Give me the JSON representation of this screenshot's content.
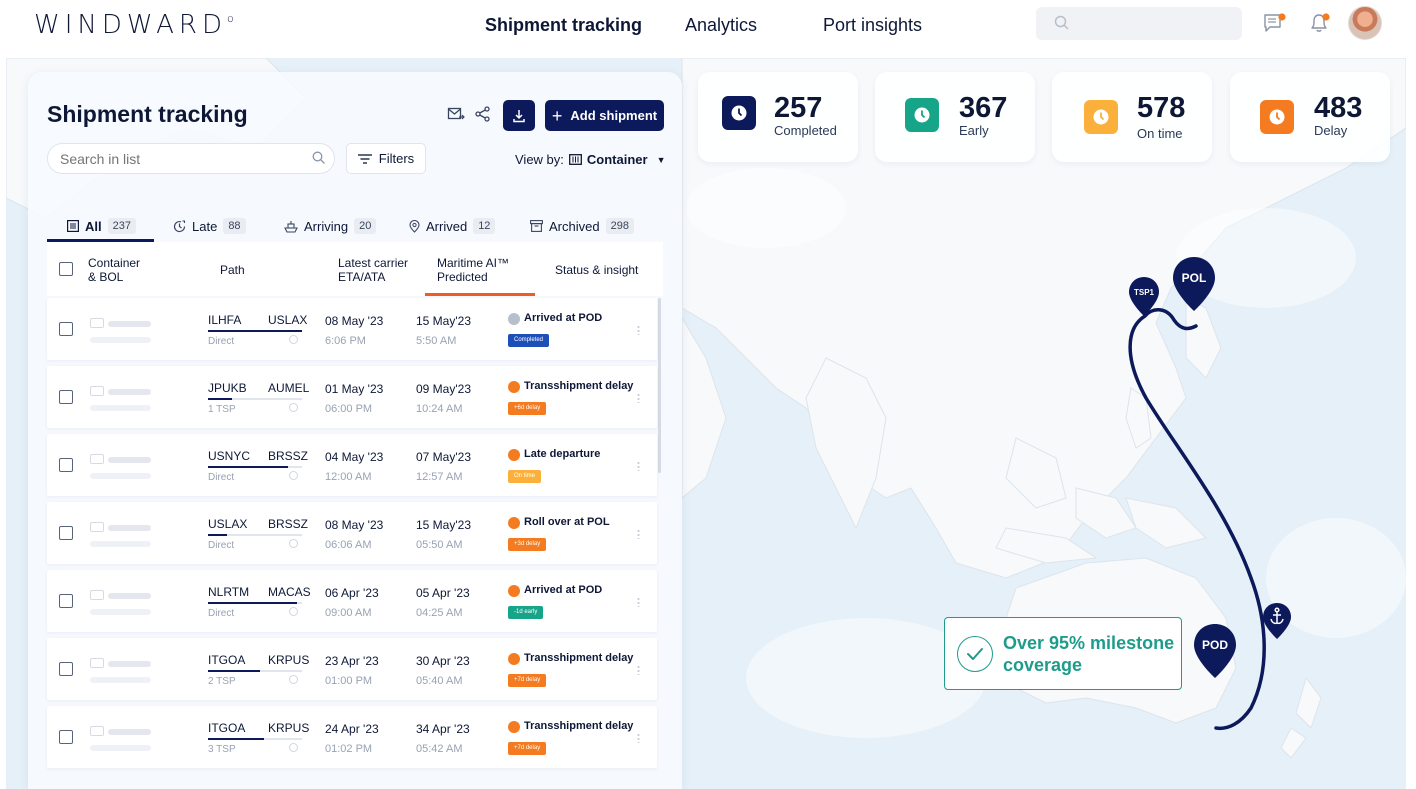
{
  "app": {
    "logo": "WINDWARD",
    "logo_mark": "o"
  },
  "nav": {
    "items": [
      {
        "label": "Shipment tracking",
        "active": true
      },
      {
        "label": "Analytics",
        "active": false
      },
      {
        "label": "Port insights",
        "active": false
      }
    ],
    "search_placeholder": "",
    "icons": [
      "search-icon",
      "messages-icon",
      "bell-icon"
    ],
    "avatar": "user-avatar"
  },
  "stats": [
    {
      "value": "257",
      "label": "Completed",
      "color": "#0c1a5b"
    },
    {
      "value": "367",
      "label": "Early",
      "color": "#17a58a"
    },
    {
      "value": "578",
      "label": "On time",
      "color": "#fbb03b"
    },
    {
      "value": "483",
      "label": "Delay",
      "color": "#f47b20"
    }
  ],
  "panel": {
    "title": "Shipment tracking",
    "add_button": "Add shipment",
    "search_placeholder": "Search in list",
    "filters_label": "Filters",
    "view_by_label": "View by:",
    "view_by_value": "Container",
    "tabs": [
      {
        "label": "All",
        "count": "237",
        "icon": "list-icon",
        "active": true
      },
      {
        "label": "Late",
        "count": "88",
        "icon": "late-clock-icon"
      },
      {
        "label": "Arriving",
        "count": "20",
        "icon": "ship-icon"
      },
      {
        "label": "Arrived",
        "count": "12",
        "icon": "location-pin-icon"
      },
      {
        "label": "Archived",
        "count": "298",
        "icon": "archive-icon"
      }
    ],
    "columns": {
      "container_1": "Container",
      "container_2": "& BOL",
      "path": "Path",
      "eta_1": "Latest carrier",
      "eta_2": "ETA/ATA",
      "ai_1": "Maritime AI™",
      "ai_2": "Predicted",
      "status": "Status & insight"
    }
  },
  "rows": [
    {
      "from": "ILHFA",
      "to": "USLAX",
      "route": "Direct",
      "progress": 1.0,
      "eta_date": "08 May '23",
      "eta_time": "6:06 PM",
      "ai_date": "15 May'23",
      "ai_time": "5:50 AM",
      "status": "Arrived at POD",
      "status_color": "#b8bfcc",
      "badge": "Completed",
      "badge_color": "#1d4fb8"
    },
    {
      "from": "JPUKB",
      "to": "AUMEL",
      "route": "1 TSP",
      "progress": 0.25,
      "eta_date": "01 May '23",
      "eta_time": "06:00 PM",
      "ai_date": "09 May'23",
      "ai_time": "10:24 AM",
      "status": "Transshipment delay",
      "status_color": "#f47b20",
      "badge": "+6d delay",
      "badge_color": "#f47b20"
    },
    {
      "from": "USNYC",
      "to": "BRSSZ",
      "route": "Direct",
      "progress": 0.85,
      "eta_date": "04 May '23",
      "eta_time": "12:00 AM",
      "ai_date": "07 May'23",
      "ai_time": "12:57 AM",
      "status": "Late departure",
      "status_color": "#f47b20",
      "badge": "On time",
      "badge_color": "#fbb03b"
    },
    {
      "from": "USLAX",
      "to": "BRSSZ",
      "route": "Direct",
      "progress": 0.2,
      "eta_date": "08 May '23",
      "eta_time": "06:06 AM",
      "ai_date": "15 May'23",
      "ai_time": "05:50 AM",
      "status": "Roll over at POL",
      "status_color": "#f47b20",
      "badge": "+3d delay",
      "badge_color": "#f47b20"
    },
    {
      "from": "NLRTM",
      "to": "MACAS",
      "route": "Direct",
      "progress": 0.95,
      "eta_date": "06 Apr '23",
      "eta_time": "09:00 AM",
      "ai_date": "05 Apr '23",
      "ai_time": "04:25 AM",
      "status": "Arrived at POD",
      "status_color": "#f47b20",
      "badge": "-1d early",
      "badge_color": "#17a58a"
    },
    {
      "from": "ITGOA",
      "to": "KRPUS",
      "route": "2 TSP",
      "progress": 0.55,
      "eta_date": "23 Apr '23",
      "eta_time": "01:00 PM",
      "ai_date": "30 Apr '23",
      "ai_time": "05:40 AM",
      "status": "Transshipment delay",
      "status_color": "#f47b20",
      "badge": "+7d delay",
      "badge_color": "#f47b20"
    },
    {
      "from": "ITGOA",
      "to": "KRPUS",
      "route": "3 TSP",
      "progress": 0.6,
      "eta_date": "24 Apr '23",
      "eta_time": "01:02 PM",
      "ai_date": "34 Apr '23",
      "ai_time": "05:42 AM",
      "status": "Transshipment delay",
      "status_color": "#f47b20",
      "badge": "+7d delay",
      "badge_color": "#f47b20"
    }
  ],
  "map": {
    "pins": [
      {
        "label": "TSP1"
      },
      {
        "label": "POL"
      },
      {
        "label": "POD"
      },
      {
        "label": "",
        "icon": "anchor-icon"
      }
    ],
    "coverage_text": "Over 95% milestone coverage",
    "route_color": "#0c1a5b",
    "coverage_color": "#1e9c8b"
  }
}
